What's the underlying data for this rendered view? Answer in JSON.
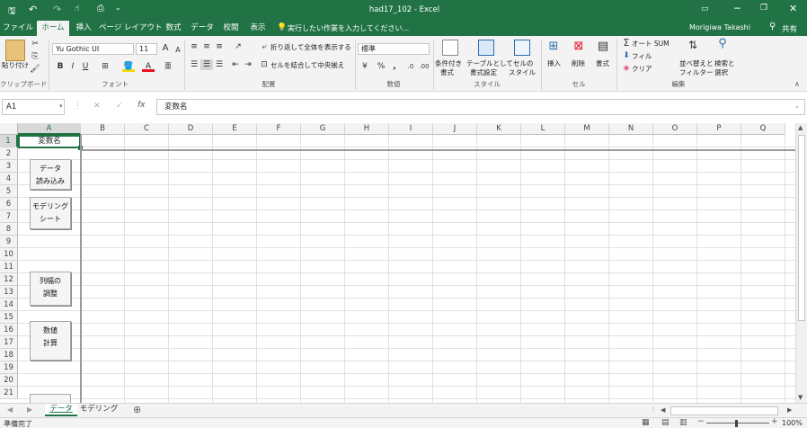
{
  "window": {
    "title": "had17_102 - Excel",
    "user": "Morigiwa Takashi",
    "share": "共有"
  },
  "qat": {
    "save": "save-icon",
    "undo": "undo-icon",
    "redo": "redo-icon",
    "touch": "touch-mode-icon",
    "print_preview": "print-preview-icon",
    "customize": "customize-qat-icon"
  },
  "tabs": [
    "ファイル",
    "ホーム",
    "挿入",
    "ページ レイアウト",
    "数式",
    "データ",
    "校閲",
    "表示"
  ],
  "active_tab": "ホーム",
  "tell_me": "実行したい作業を入力してください...",
  "ribbon": {
    "clipboard": {
      "paste": "貼り付け",
      "group": "クリップボード"
    },
    "font": {
      "name": "Yu Gothic UI",
      "size": "11",
      "group": "フォント",
      "bold": "B",
      "italic": "I",
      "underline": "U",
      "grow": "A",
      "shrink": "A",
      "font_color": "A"
    },
    "alignment": {
      "wrap": "折り返して全体を表示する",
      "merge": "セルを結合して中央揃え",
      "group": "配置"
    },
    "number": {
      "format": "標準",
      "percent": "%",
      "comma": ",",
      "group": "数値"
    },
    "styles": {
      "conditional_l1": "条件付き",
      "conditional_l2": "書式",
      "table_l1": "テーブルとして",
      "table_l2": "書式設定",
      "cell_l1": "セルの",
      "cell_l2": "スタイル",
      "group": "スタイル"
    },
    "cells": {
      "insert": "挿入",
      "delete": "削除",
      "format": "書式",
      "group": "セル"
    },
    "editing": {
      "autosum": "オート SUM",
      "fill": "フィル",
      "clear": "クリア",
      "sort_l1": "並べ替えと",
      "sort_l2": "フィルター",
      "find_l1": "検索と",
      "find_l2": "選択",
      "group": "編集"
    }
  },
  "formula_bar": {
    "name_box": "A1",
    "cancel": "✕",
    "enter": "✓",
    "fx": "fx",
    "value": "変数名"
  },
  "grid": {
    "columns": [
      "A",
      "B",
      "C",
      "D",
      "E",
      "F",
      "G",
      "H",
      "I",
      "J",
      "K",
      "L",
      "M",
      "N",
      "O",
      "P",
      "Q"
    ],
    "rows": [
      "1",
      "2",
      "3",
      "4",
      "5",
      "6",
      "7",
      "8",
      "9",
      "10",
      "11",
      "12",
      "13",
      "14",
      "15",
      "16",
      "17",
      "18",
      "19",
      "20",
      "21"
    ],
    "a1": "変数名"
  },
  "buttons": [
    {
      "name": "data-load-button",
      "label": "データ\n読み込み"
    },
    {
      "name": "modeling-sheet-button",
      "label": "モデリング\nシート"
    },
    {
      "name": "column-width-button",
      "label": "列幅の\n調整"
    },
    {
      "name": "numeric-calc-button",
      "label": "数値\n計算"
    }
  ],
  "sheets": [
    {
      "label": "データ",
      "active": true
    },
    {
      "label": "モデリング",
      "active": false
    }
  ],
  "status": {
    "text": "準備完了",
    "zoom": "100%"
  }
}
